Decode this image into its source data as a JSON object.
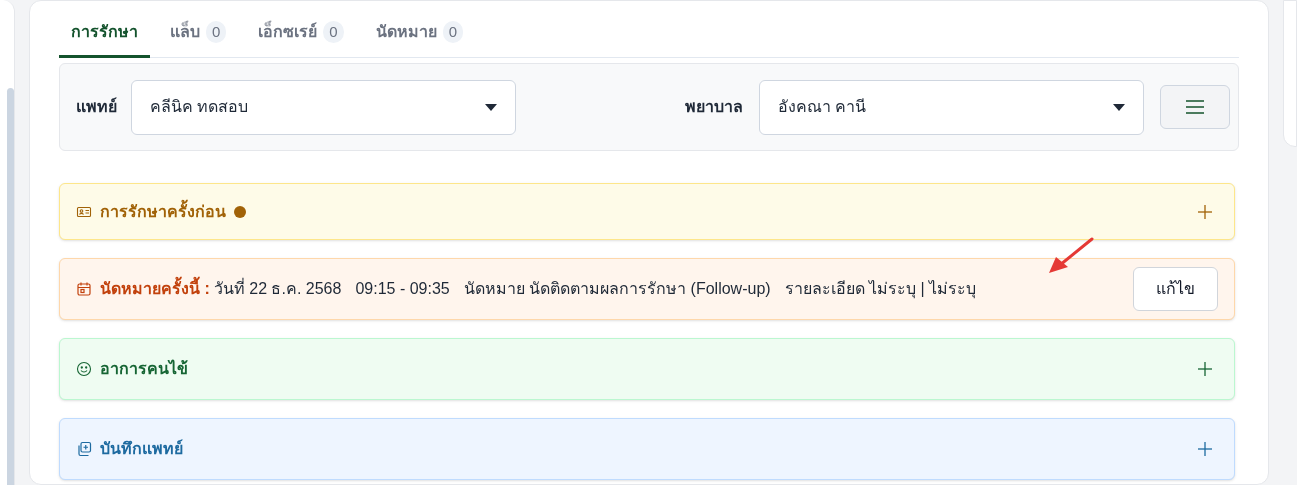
{
  "tabs": [
    {
      "label": "การรักษา",
      "selected": true
    },
    {
      "label": "แล็บ",
      "count": "0",
      "selected": false
    },
    {
      "label": "เอ็กซเรย์",
      "count": "0",
      "selected": false
    },
    {
      "label": "นัดหมาย",
      "count": "0",
      "selected": false
    }
  ],
  "filters": {
    "doctor": {
      "label": "แพทย์",
      "value": "คลีนิค ทดสอบ"
    },
    "nurse": {
      "label": "พยาบาล",
      "value": "อังคณา คานี"
    }
  },
  "sections": [
    {
      "kind": "previous",
      "title": "การรักษาครั้งก่อน",
      "expanded": false,
      "color": "#a16207"
    },
    {
      "kind": "appointment",
      "title": "นัดหมายครั้งนี้ :",
      "details": [
        "วันที่ 22 ธ.ค. 2568",
        "09:15 - 09:35",
        "นัดหมาย นัดติดตามผลการรักษา (Follow-up)",
        "รายละเอียด ไม่ระบุ | ไม่ระบุ"
      ],
      "button": "แก้ไข"
    },
    {
      "kind": "symptoms",
      "title": "อาการคนไข้",
      "expanded": false
    },
    {
      "kind": "doctor_note",
      "title": "บันทึกแพทย์",
      "expanded": false
    }
  ]
}
